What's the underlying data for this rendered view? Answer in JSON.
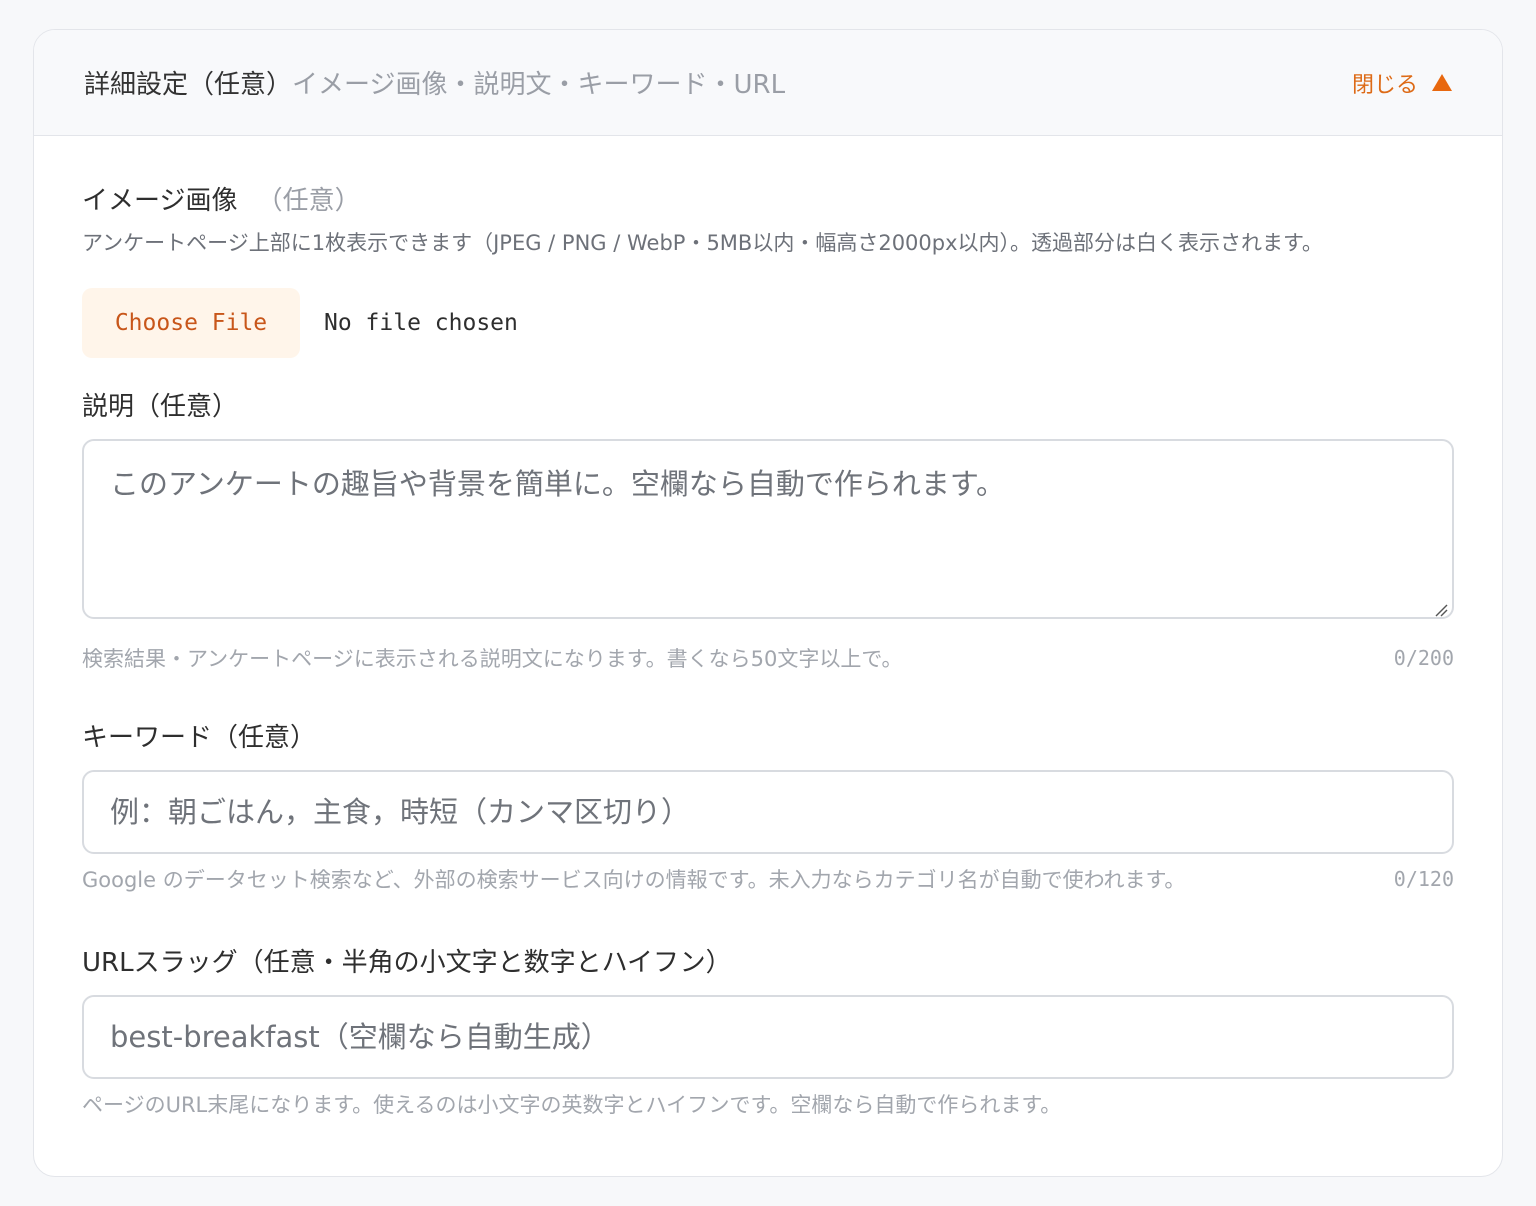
{
  "header": {
    "title": "詳細設定（任意）",
    "subtitle": "イメージ画像・説明文・キーワード・URL",
    "toggle_label": "閉じる"
  },
  "image": {
    "label": "イメージ画像",
    "optional": "（任意）",
    "help": "アンケートページ上部に1枚表示できます（JPEG / PNG / WebP・5MB以内・幅高さ2000px以内）。透過部分は白く表示されます。",
    "button_label": "Choose File",
    "status": "No file chosen"
  },
  "description": {
    "label": "説明（任意）",
    "placeholder": "このアンケートの趣旨や背景を簡単に。空欄なら自動で作られます。",
    "hint": "検索結果・アンケートページに表示される説明文になります。書くなら50文字以上で。",
    "counter": "0/200"
  },
  "keywords": {
    "label": "キーワード（任意）",
    "placeholder": "例：朝ごはん，主食，時短（カンマ区切り）",
    "hint": "Google のデータセット検索など、外部の検索サービス向けの情報です。未入力ならカテゴリ名が自動で使われます。",
    "counter": "0/120"
  },
  "slug": {
    "label": "URLスラッグ（任意・半角の小文字と数字とハイフン）",
    "placeholder": "best-breakfast（空欄なら自動生成）",
    "hint": "ページのURL末尾になります。使えるのは小文字の英数字とハイフンです。空欄なら自動で作られます。"
  },
  "icons": {
    "toggle": "triangle-up-icon",
    "resize": "resize-handle-icon"
  },
  "colors": {
    "accent": "#e8680f",
    "button_bg": "#fff5ea",
    "border": "#d8dbe0"
  }
}
